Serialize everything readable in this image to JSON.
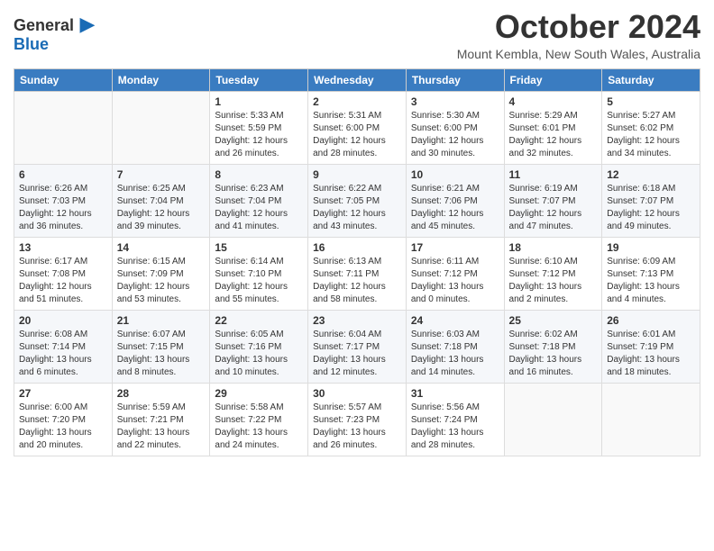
{
  "logo": {
    "general": "General",
    "blue": "Blue"
  },
  "title": {
    "month": "October 2024",
    "location": "Mount Kembla, New South Wales, Australia"
  },
  "weekdays": [
    "Sunday",
    "Monday",
    "Tuesday",
    "Wednesday",
    "Thursday",
    "Friday",
    "Saturday"
  ],
  "days": [
    {
      "date": "",
      "sunrise": "",
      "sunset": "",
      "daylight": ""
    },
    {
      "date": "",
      "sunrise": "",
      "sunset": "",
      "daylight": ""
    },
    {
      "date": "1",
      "sunrise": "Sunrise: 5:33 AM",
      "sunset": "Sunset: 5:59 PM",
      "daylight": "Daylight: 12 hours and 26 minutes."
    },
    {
      "date": "2",
      "sunrise": "Sunrise: 5:31 AM",
      "sunset": "Sunset: 6:00 PM",
      "daylight": "Daylight: 12 hours and 28 minutes."
    },
    {
      "date": "3",
      "sunrise": "Sunrise: 5:30 AM",
      "sunset": "Sunset: 6:00 PM",
      "daylight": "Daylight: 12 hours and 30 minutes."
    },
    {
      "date": "4",
      "sunrise": "Sunrise: 5:29 AM",
      "sunset": "Sunset: 6:01 PM",
      "daylight": "Daylight: 12 hours and 32 minutes."
    },
    {
      "date": "5",
      "sunrise": "Sunrise: 5:27 AM",
      "sunset": "Sunset: 6:02 PM",
      "daylight": "Daylight: 12 hours and 34 minutes."
    },
    {
      "date": "6",
      "sunrise": "Sunrise: 6:26 AM",
      "sunset": "Sunset: 7:03 PM",
      "daylight": "Daylight: 12 hours and 36 minutes."
    },
    {
      "date": "7",
      "sunrise": "Sunrise: 6:25 AM",
      "sunset": "Sunset: 7:04 PM",
      "daylight": "Daylight: 12 hours and 39 minutes."
    },
    {
      "date": "8",
      "sunrise": "Sunrise: 6:23 AM",
      "sunset": "Sunset: 7:04 PM",
      "daylight": "Daylight: 12 hours and 41 minutes."
    },
    {
      "date": "9",
      "sunrise": "Sunrise: 6:22 AM",
      "sunset": "Sunset: 7:05 PM",
      "daylight": "Daylight: 12 hours and 43 minutes."
    },
    {
      "date": "10",
      "sunrise": "Sunrise: 6:21 AM",
      "sunset": "Sunset: 7:06 PM",
      "daylight": "Daylight: 12 hours and 45 minutes."
    },
    {
      "date": "11",
      "sunrise": "Sunrise: 6:19 AM",
      "sunset": "Sunset: 7:07 PM",
      "daylight": "Daylight: 12 hours and 47 minutes."
    },
    {
      "date": "12",
      "sunrise": "Sunrise: 6:18 AM",
      "sunset": "Sunset: 7:07 PM",
      "daylight": "Daylight: 12 hours and 49 minutes."
    },
    {
      "date": "13",
      "sunrise": "Sunrise: 6:17 AM",
      "sunset": "Sunset: 7:08 PM",
      "daylight": "Daylight: 12 hours and 51 minutes."
    },
    {
      "date": "14",
      "sunrise": "Sunrise: 6:15 AM",
      "sunset": "Sunset: 7:09 PM",
      "daylight": "Daylight: 12 hours and 53 minutes."
    },
    {
      "date": "15",
      "sunrise": "Sunrise: 6:14 AM",
      "sunset": "Sunset: 7:10 PM",
      "daylight": "Daylight: 12 hours and 55 minutes."
    },
    {
      "date": "16",
      "sunrise": "Sunrise: 6:13 AM",
      "sunset": "Sunset: 7:11 PM",
      "daylight": "Daylight: 12 hours and 58 minutes."
    },
    {
      "date": "17",
      "sunrise": "Sunrise: 6:11 AM",
      "sunset": "Sunset: 7:12 PM",
      "daylight": "Daylight: 13 hours and 0 minutes."
    },
    {
      "date": "18",
      "sunrise": "Sunrise: 6:10 AM",
      "sunset": "Sunset: 7:12 PM",
      "daylight": "Daylight: 13 hours and 2 minutes."
    },
    {
      "date": "19",
      "sunrise": "Sunrise: 6:09 AM",
      "sunset": "Sunset: 7:13 PM",
      "daylight": "Daylight: 13 hours and 4 minutes."
    },
    {
      "date": "20",
      "sunrise": "Sunrise: 6:08 AM",
      "sunset": "Sunset: 7:14 PM",
      "daylight": "Daylight: 13 hours and 6 minutes."
    },
    {
      "date": "21",
      "sunrise": "Sunrise: 6:07 AM",
      "sunset": "Sunset: 7:15 PM",
      "daylight": "Daylight: 13 hours and 8 minutes."
    },
    {
      "date": "22",
      "sunrise": "Sunrise: 6:05 AM",
      "sunset": "Sunset: 7:16 PM",
      "daylight": "Daylight: 13 hours and 10 minutes."
    },
    {
      "date": "23",
      "sunrise": "Sunrise: 6:04 AM",
      "sunset": "Sunset: 7:17 PM",
      "daylight": "Daylight: 13 hours and 12 minutes."
    },
    {
      "date": "24",
      "sunrise": "Sunrise: 6:03 AM",
      "sunset": "Sunset: 7:18 PM",
      "daylight": "Daylight: 13 hours and 14 minutes."
    },
    {
      "date": "25",
      "sunrise": "Sunrise: 6:02 AM",
      "sunset": "Sunset: 7:18 PM",
      "daylight": "Daylight: 13 hours and 16 minutes."
    },
    {
      "date": "26",
      "sunrise": "Sunrise: 6:01 AM",
      "sunset": "Sunset: 7:19 PM",
      "daylight": "Daylight: 13 hours and 18 minutes."
    },
    {
      "date": "27",
      "sunrise": "Sunrise: 6:00 AM",
      "sunset": "Sunset: 7:20 PM",
      "daylight": "Daylight: 13 hours and 20 minutes."
    },
    {
      "date": "28",
      "sunrise": "Sunrise: 5:59 AM",
      "sunset": "Sunset: 7:21 PM",
      "daylight": "Daylight: 13 hours and 22 minutes."
    },
    {
      "date": "29",
      "sunrise": "Sunrise: 5:58 AM",
      "sunset": "Sunset: 7:22 PM",
      "daylight": "Daylight: 13 hours and 24 minutes."
    },
    {
      "date": "30",
      "sunrise": "Sunrise: 5:57 AM",
      "sunset": "Sunset: 7:23 PM",
      "daylight": "Daylight: 13 hours and 26 minutes."
    },
    {
      "date": "31",
      "sunrise": "Sunrise: 5:56 AM",
      "sunset": "Sunset: 7:24 PM",
      "daylight": "Daylight: 13 hours and 28 minutes."
    },
    {
      "date": "",
      "sunrise": "",
      "sunset": "",
      "daylight": ""
    },
    {
      "date": "",
      "sunrise": "",
      "sunset": "",
      "daylight": ""
    }
  ]
}
